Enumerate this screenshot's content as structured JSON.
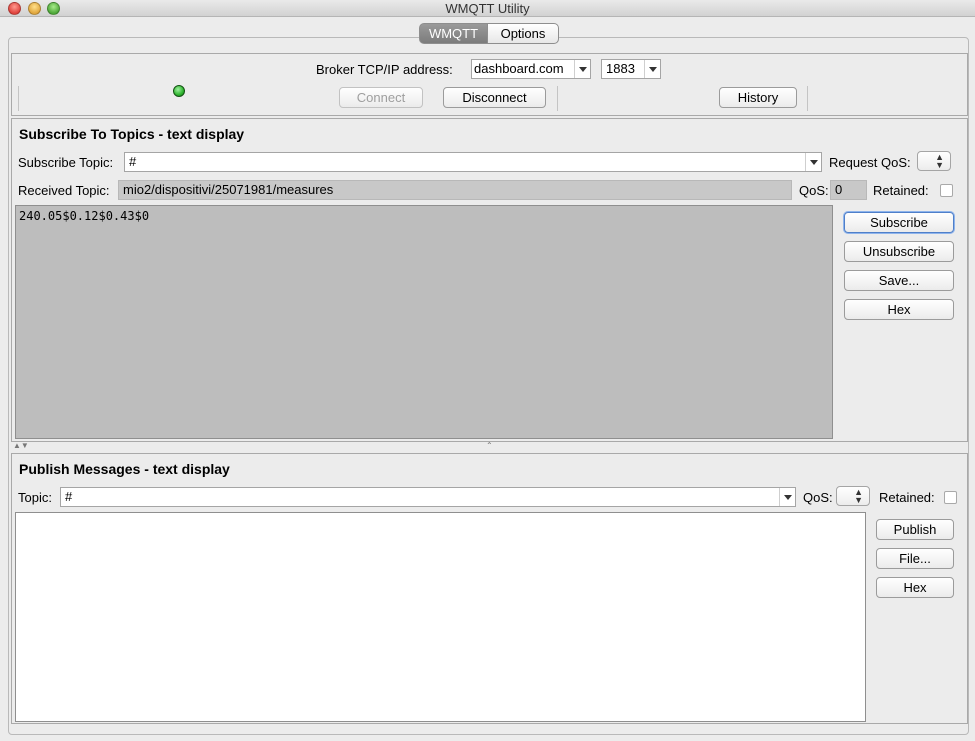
{
  "window": {
    "title": "WMQTT Utility"
  },
  "tabs": [
    {
      "label": "WMQTT",
      "selected": true
    },
    {
      "label": "Options",
      "selected": false
    }
  ],
  "connection": {
    "broker_label": "Broker TCP/IP address:",
    "broker_value": "dashboard.com",
    "port_value": "1883",
    "connect_label": "Connect",
    "disconnect_label": "Disconnect",
    "history_label": "History",
    "status_color": "#2fb52f"
  },
  "subscribe": {
    "title": "Subscribe To Topics - text display",
    "topic_label": "Subscribe Topic:",
    "topic_value": "#",
    "request_qos_label": "Request QoS:",
    "received_topic_label": "Received Topic:",
    "received_topic_value": "mio2/dispositivi/25071981/measures",
    "qos_label": "QoS:",
    "qos_value": "0",
    "retained_label": "Retained:",
    "message_text": "240.05$0.12$0.43$0",
    "buttons": {
      "subscribe": "Subscribe",
      "unsubscribe": "Unsubscribe",
      "save": "Save...",
      "hex": "Hex"
    }
  },
  "publish": {
    "title": "Publish Messages - text display",
    "topic_label": "Topic:",
    "topic_value": "#",
    "qos_label": "QoS:",
    "retained_label": "Retained:",
    "message_text": "",
    "buttons": {
      "publish": "Publish",
      "file": "File...",
      "hex": "Hex"
    }
  }
}
